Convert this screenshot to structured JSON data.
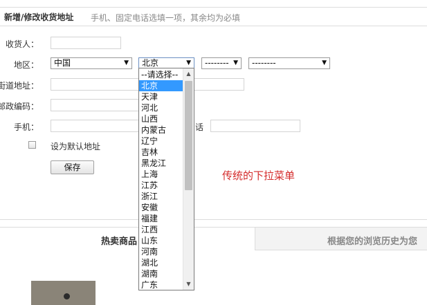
{
  "header": {
    "title": "新增/修改收货地址",
    "hint": "手机、固定电话选填一项，其余均为必填"
  },
  "form": {
    "receiver_label": "收货人：",
    "region_label": "地区：",
    "street_label": "街道地址：",
    "postcode_label": "邮政编码：",
    "mobile_label": "手机：",
    "phone_label": "话",
    "country_select": "中国",
    "province_select": "北京",
    "city_select": "--------",
    "district_select": "--------",
    "default_checkbox_label": "设为默认地址",
    "save_button": "保存"
  },
  "dropdown": {
    "options": [
      "--请选择--",
      "北京",
      "天津",
      "河北",
      "山西",
      "内蒙古",
      "辽宁",
      "吉林",
      "黑龙江",
      "上海",
      "江苏",
      "浙江",
      "安徽",
      "福建",
      "江西",
      "山东",
      "河南",
      "湖北",
      "湖南",
      "广东"
    ],
    "highlighted": "北京"
  },
  "annotation": "传统的下拉菜单",
  "bottom": {
    "hot_title": "热卖商品",
    "history_tab": "根据您的浏览历史为您"
  },
  "colors": {
    "annotation": "#d42a2a",
    "highlight": "#3399ff"
  }
}
